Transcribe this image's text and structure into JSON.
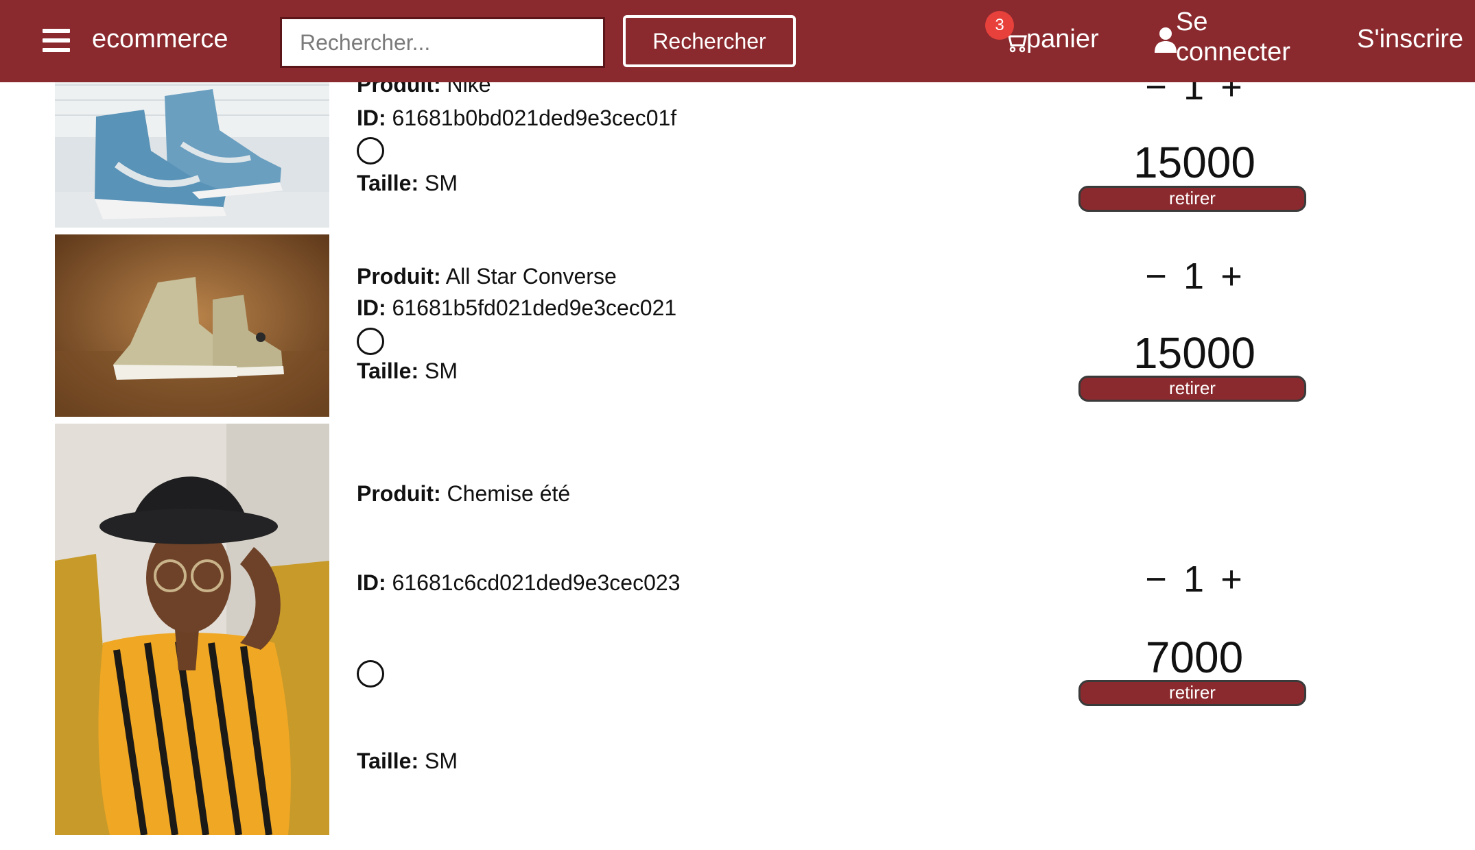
{
  "navbar": {
    "brand": "ecommerce",
    "search_placeholder": "Rechercher...",
    "search_button": "Rechercher",
    "cart_label": "panier",
    "cart_count": "3",
    "login_line1": "Se",
    "login_line2": "connecter",
    "register": "S'inscrire",
    "background_color": "#8b2a2e",
    "badge_color": "#e8413c"
  },
  "labels": {
    "product": "Produit:",
    "id": "ID:",
    "size": "Taille:",
    "remove": "retirer",
    "minus": "−",
    "plus": "+"
  },
  "items": [
    {
      "product": "Nike",
      "id": "61681b0bd021ded9e3cec01f",
      "size": "SM",
      "quantity": "1",
      "price": "15000",
      "image": "blue-high-top-sneakers-photo"
    },
    {
      "product": "All Star Converse",
      "id": "61681b5fd021ded9e3cec021",
      "size": "SM",
      "quantity": "1",
      "price": "15000",
      "image": "beige-converse-sneakers-photo"
    },
    {
      "product": "Chemise été",
      "id": "61681c6cd021ded9e3cec023",
      "size": "SM",
      "quantity": "1",
      "price": "7000",
      "image": "man-in-striped-shirt-and-hat-photo"
    }
  ]
}
